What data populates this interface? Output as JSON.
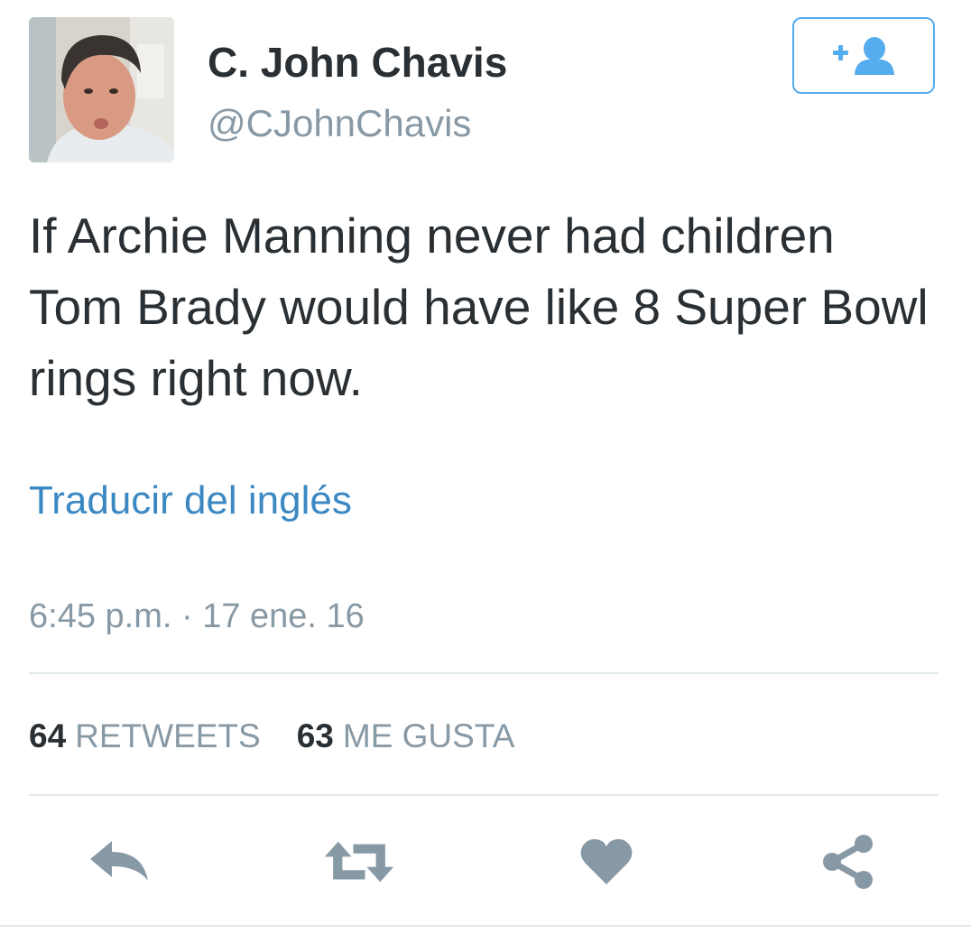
{
  "tweet": {
    "author": {
      "display_name": "C. John Chavis",
      "screen_name": "@CJohnChavis"
    },
    "text": "If Archie Manning never had children Tom Brady would have like 8 Super Bowl rings right now.",
    "translate_label": "Traducir del inglés",
    "timestamp": "6:45 p.m. · 17 ene. 16",
    "stats": {
      "retweets_count": "64",
      "retweets_label": "RETWEETS",
      "likes_count": "63",
      "likes_label": "ME GUSTA"
    },
    "actions": [
      "reply-icon",
      "retweet-icon",
      "heart-icon",
      "share-icon"
    ]
  },
  "colors": {
    "accent": "#55acee",
    "link": "#3b88c3",
    "text": "#292f33",
    "muted": "#8899a6",
    "action_icon": "#8899a6",
    "divider": "#e1e8ed"
  }
}
